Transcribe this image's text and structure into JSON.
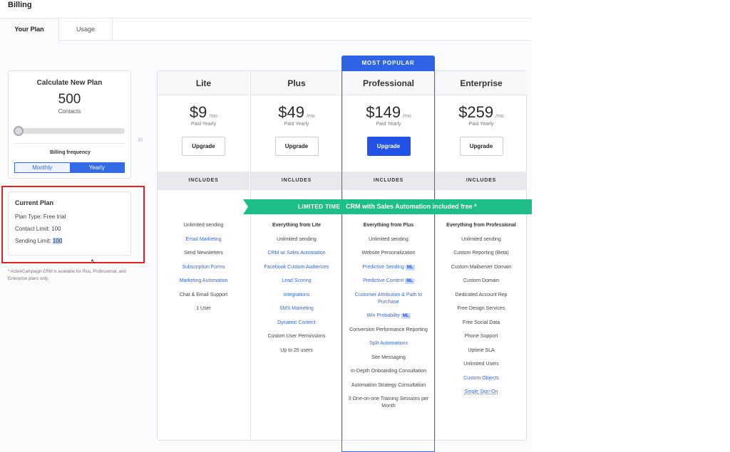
{
  "header": {
    "title": "Billing"
  },
  "tabs": [
    {
      "label": "Your Plan",
      "active": true
    },
    {
      "label": "Usage",
      "active": false
    }
  ],
  "calculator": {
    "title": "Calculate New Plan",
    "contacts_value": "500",
    "contacts_unit": "Contacts",
    "slider_fraction": 0.0,
    "billing_label": "Billing frequency",
    "options": [
      "Monthly",
      "Yearly"
    ],
    "selected": "Yearly"
  },
  "current_plan": {
    "title": "Current Plan",
    "plan_type": "Plan Type: Free trial",
    "contact_limit": "Contact Limit: 100",
    "sending_label": "Sending Limit: ",
    "sending_value": "100"
  },
  "footnote": "* ActiveCampaign CRM is available for Plus, Professional, and Enterprise plans only.",
  "chevrons": "»",
  "cursor": "↖",
  "most_popular": "MOST POPULAR",
  "ribbon": {
    "tag": "LIMITED TIME",
    "text": "CRM with Sales Automation included free *"
  },
  "accent_colors": {
    "primary": "#2353e6",
    "ribbon": "#1cbf86",
    "highlight": "#e02323"
  },
  "plans": [
    {
      "name": "Lite",
      "price": "$9",
      "per": "/mo",
      "billing": "Paid Yearly",
      "button": "Upgrade",
      "includes": "INCLUDES",
      "features": [
        {
          "text": "Unlimited sending",
          "style": "plain"
        },
        {
          "text": "Email Marketing",
          "style": "link"
        },
        {
          "text": "Send Newsletters",
          "style": "plain"
        },
        {
          "text": "Subscription Forms",
          "style": "link"
        },
        {
          "text": "Marketing Automation",
          "style": "link"
        },
        {
          "text": "Chat & Email Support",
          "style": "plain"
        },
        {
          "text": "1 User",
          "style": "plain"
        }
      ]
    },
    {
      "name": "Plus",
      "price": "$49",
      "per": "/mo",
      "billing": "Paid Yearly",
      "button": "Upgrade",
      "includes": "INCLUDES",
      "features": [
        {
          "text": "Everything from Lite",
          "style": "bold"
        },
        {
          "text": "Unlimited sending",
          "style": "plain"
        },
        {
          "text": "CRM w/ Sales Automation",
          "style": "link"
        },
        {
          "text": "Facebook Custom Audiences",
          "style": "link"
        },
        {
          "text": "Lead Scoring",
          "style": "link"
        },
        {
          "text": "Integrations",
          "style": "link"
        },
        {
          "text": "SMS Marketing",
          "style": "link"
        },
        {
          "text": "Dynamic Content",
          "style": "link"
        },
        {
          "text": "Custom User Permissions",
          "style": "plain"
        },
        {
          "text": "Up to 25 users",
          "style": "plain"
        }
      ]
    },
    {
      "name": "Professional",
      "price": "$149",
      "per": "/mo",
      "billing": "Paid Yearly",
      "button": "Upgrade",
      "includes": "INCLUDES",
      "features": [
        {
          "text": "Everything from Plus",
          "style": "bold"
        },
        {
          "text": "Unlimited sending",
          "style": "plain"
        },
        {
          "text": "Website Personalization",
          "style": "plain"
        },
        {
          "text": "Predictive Sending",
          "style": "link",
          "badge": "ML"
        },
        {
          "text": "Predictive Content",
          "style": "link",
          "badge": "ML"
        },
        {
          "text": "Customer Attribution & Path to Purchase",
          "style": "link"
        },
        {
          "text": "Win Probability",
          "style": "link",
          "badge": "ML"
        },
        {
          "text": "Conversion Performance Reporting",
          "style": "plain"
        },
        {
          "text": "Split Automations",
          "style": "link"
        },
        {
          "text": "Site Messaging",
          "style": "plain"
        },
        {
          "text": "In-Depth Onboarding Consultation",
          "style": "plain"
        },
        {
          "text": "Automation Strategy Consultation",
          "style": "plain"
        },
        {
          "text": "3 One-on-one Training Sessions per Month",
          "style": "plain"
        }
      ]
    },
    {
      "name": "Enterprise",
      "price": "$259",
      "per": "/mo",
      "billing": "Paid Yearly",
      "button": "Upgrade",
      "includes": "INCLUDES",
      "features": [
        {
          "text": "Everything from Professional",
          "style": "bold"
        },
        {
          "text": "Unlimited sending",
          "style": "plain"
        },
        {
          "text": "Custom Reporting (Beta)",
          "style": "plain"
        },
        {
          "text": "Custom Mailserver Domain",
          "style": "plain"
        },
        {
          "text": "Custom Domain",
          "style": "plain"
        },
        {
          "text": "Dedicated Account Rep",
          "style": "plain"
        },
        {
          "text": "Free Design Services",
          "style": "plain"
        },
        {
          "text": "Free Social Data",
          "style": "plain"
        },
        {
          "text": "Phone Support",
          "style": "plain"
        },
        {
          "text": "Uptime SLA",
          "style": "plain"
        },
        {
          "text": "Unlimited Users",
          "style": "plain"
        },
        {
          "text": "Custom Objects",
          "style": "link"
        },
        {
          "text": "Single Sign-On",
          "style": "link-under"
        }
      ]
    }
  ]
}
